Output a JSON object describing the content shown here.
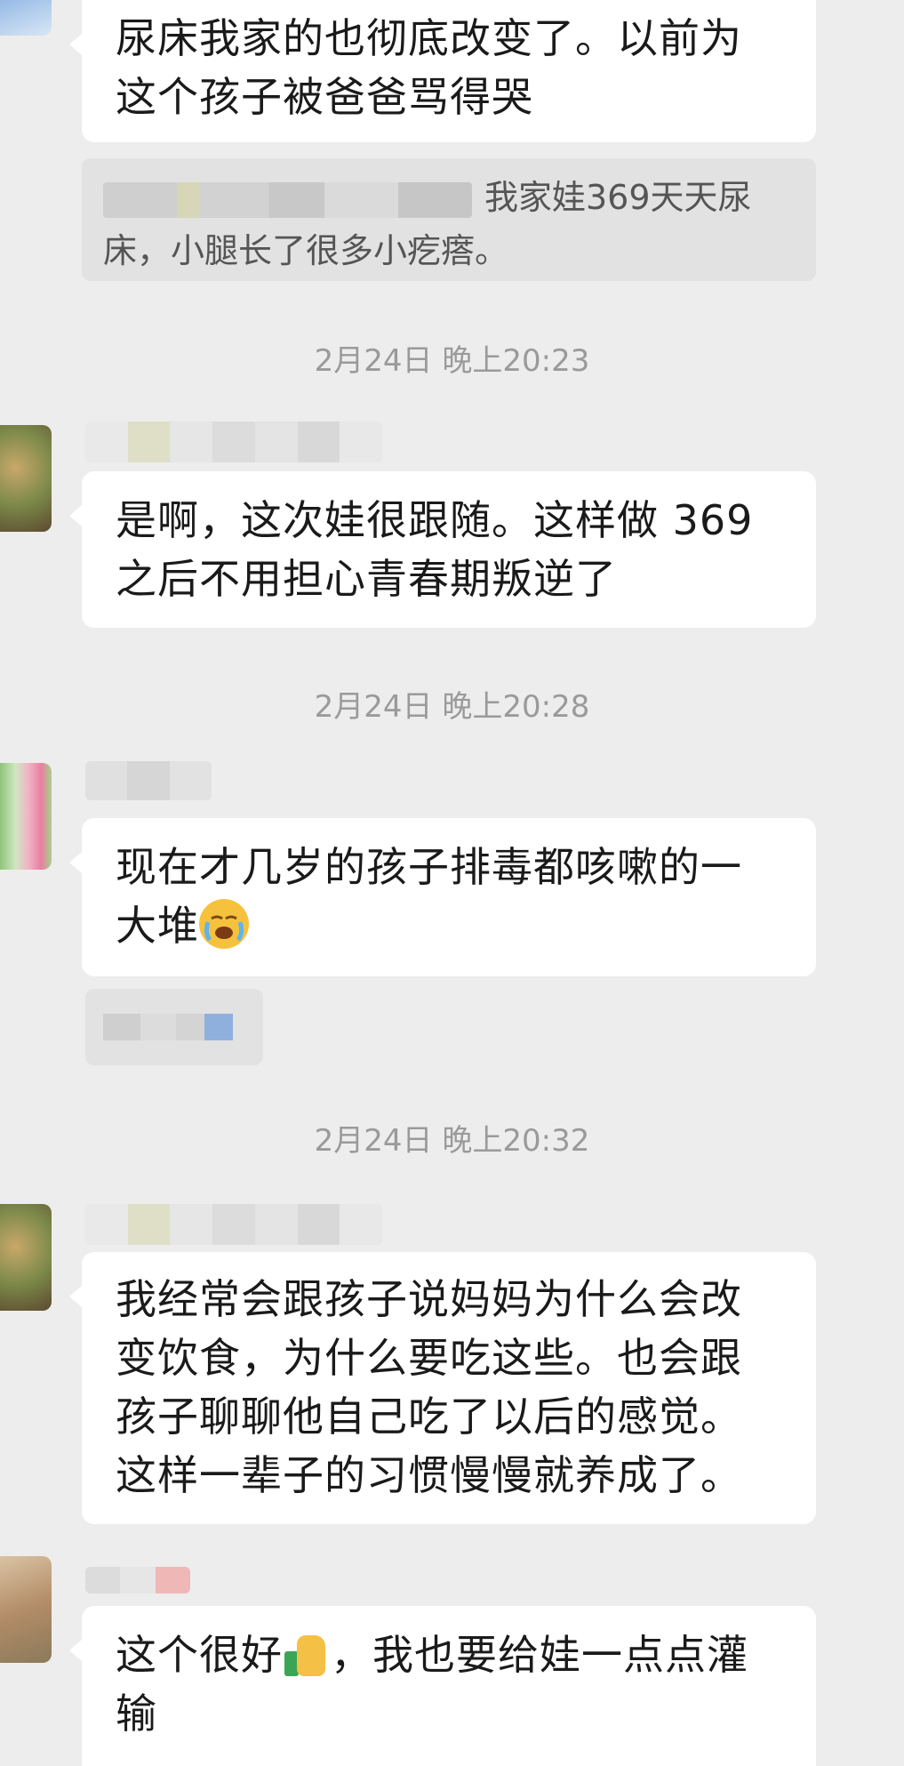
{
  "messages": [
    {
      "type": "text",
      "text": "尿床我家的也彻底改变了。以前为这个孩子被爸爸骂得哭"
    },
    {
      "type": "quote",
      "text": "我家娃369天天尿床，小腿长了很多小疙瘩。"
    },
    {
      "type": "time",
      "text": "2月24日 晚上20:23"
    },
    {
      "type": "text",
      "text": "是啊，这次娃很跟随。这样做 369之后不用担心青春期叛逆了"
    },
    {
      "type": "time",
      "text": "2月24日 晚上20:28"
    },
    {
      "type": "text",
      "text": "现在才几岁的孩子排毒都咳嗽的一大堆"
    },
    {
      "type": "time",
      "text": "2月24日 晚上20:32"
    },
    {
      "type": "text",
      "text": "我经常会跟孩子说妈妈为什么会改变饮食，为什么要吃这些。也会跟孩子聊聊他自己吃了以后的感觉。这样一辈子的习惯慢慢就养成了。"
    },
    {
      "type": "text",
      "text": "这个很好，我也要给娃一点点灌输"
    }
  ],
  "lines": {
    "m1a": "尿床我家的也彻底改变了。以前为",
    "m1b": "这个孩子被爸爸骂得哭",
    "q1a": "我家娃369天天尿",
    "q1b": "床，小腿长了很多小疙瘩。",
    "t1": "2月24日 晚上20:23",
    "m2a": "是啊，这次娃很跟随。这样做 369",
    "m2b": "之后不用担心青春期叛逆了",
    "t2": "2月24日 晚上20:28",
    "m3a": "现在才几岁的孩子排毒都咳嗽的一",
    "m3b": "大堆",
    "t3": "2月24日 晚上20:32",
    "m4a": "我经常会跟孩子说妈妈为什么会改",
    "m4b": "变饮食，为什么要吃这些。也会跟",
    "m4c": "孩子聊聊他自己吃了以后的感觉。",
    "m4d": "这样一辈子的习惯慢慢就养成了。",
    "m5a": "这个很好",
    "m5b": "，我也要给娃一点点灌",
    "m5c": "输"
  },
  "icons": {
    "emoji_crying": "loudly-crying-face",
    "emoji_thumbs": "thumbs-up"
  },
  "colors": {
    "background": "#ededed",
    "bubble": "#ffffff",
    "timestamp": "#9a9a9a"
  }
}
